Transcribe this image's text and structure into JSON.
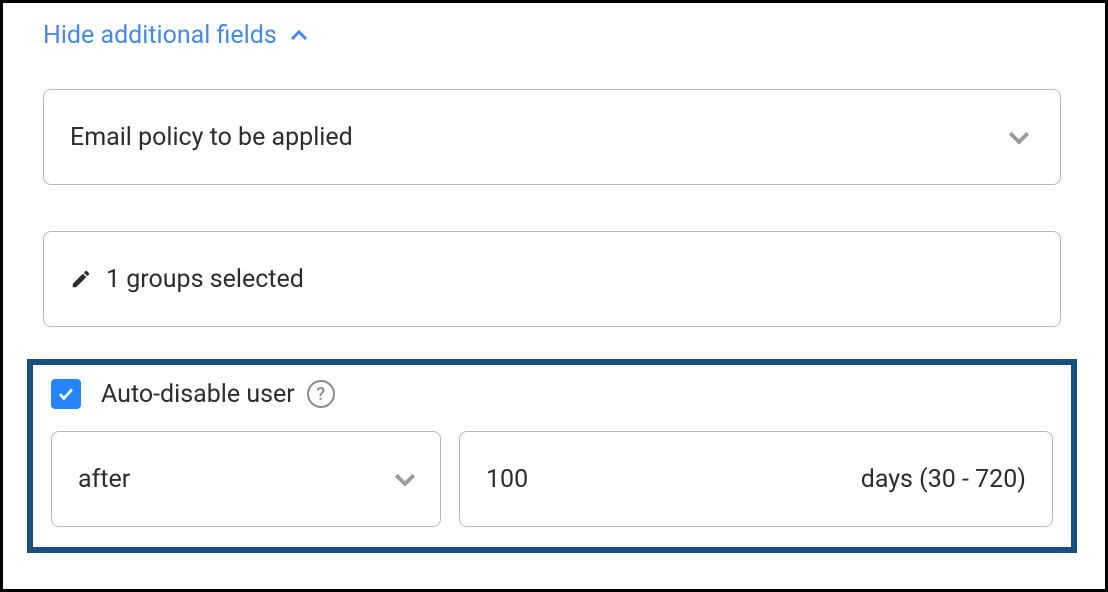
{
  "toggle": {
    "label": "Hide additional fields"
  },
  "emailPolicy": {
    "placeholder": "Email policy to be applied"
  },
  "groups": {
    "text": "1 groups selected"
  },
  "autoDisable": {
    "label": "Auto-disable user",
    "checked": true,
    "timing": "after",
    "value": "100",
    "unitHint": "days (30 - 720)"
  }
}
